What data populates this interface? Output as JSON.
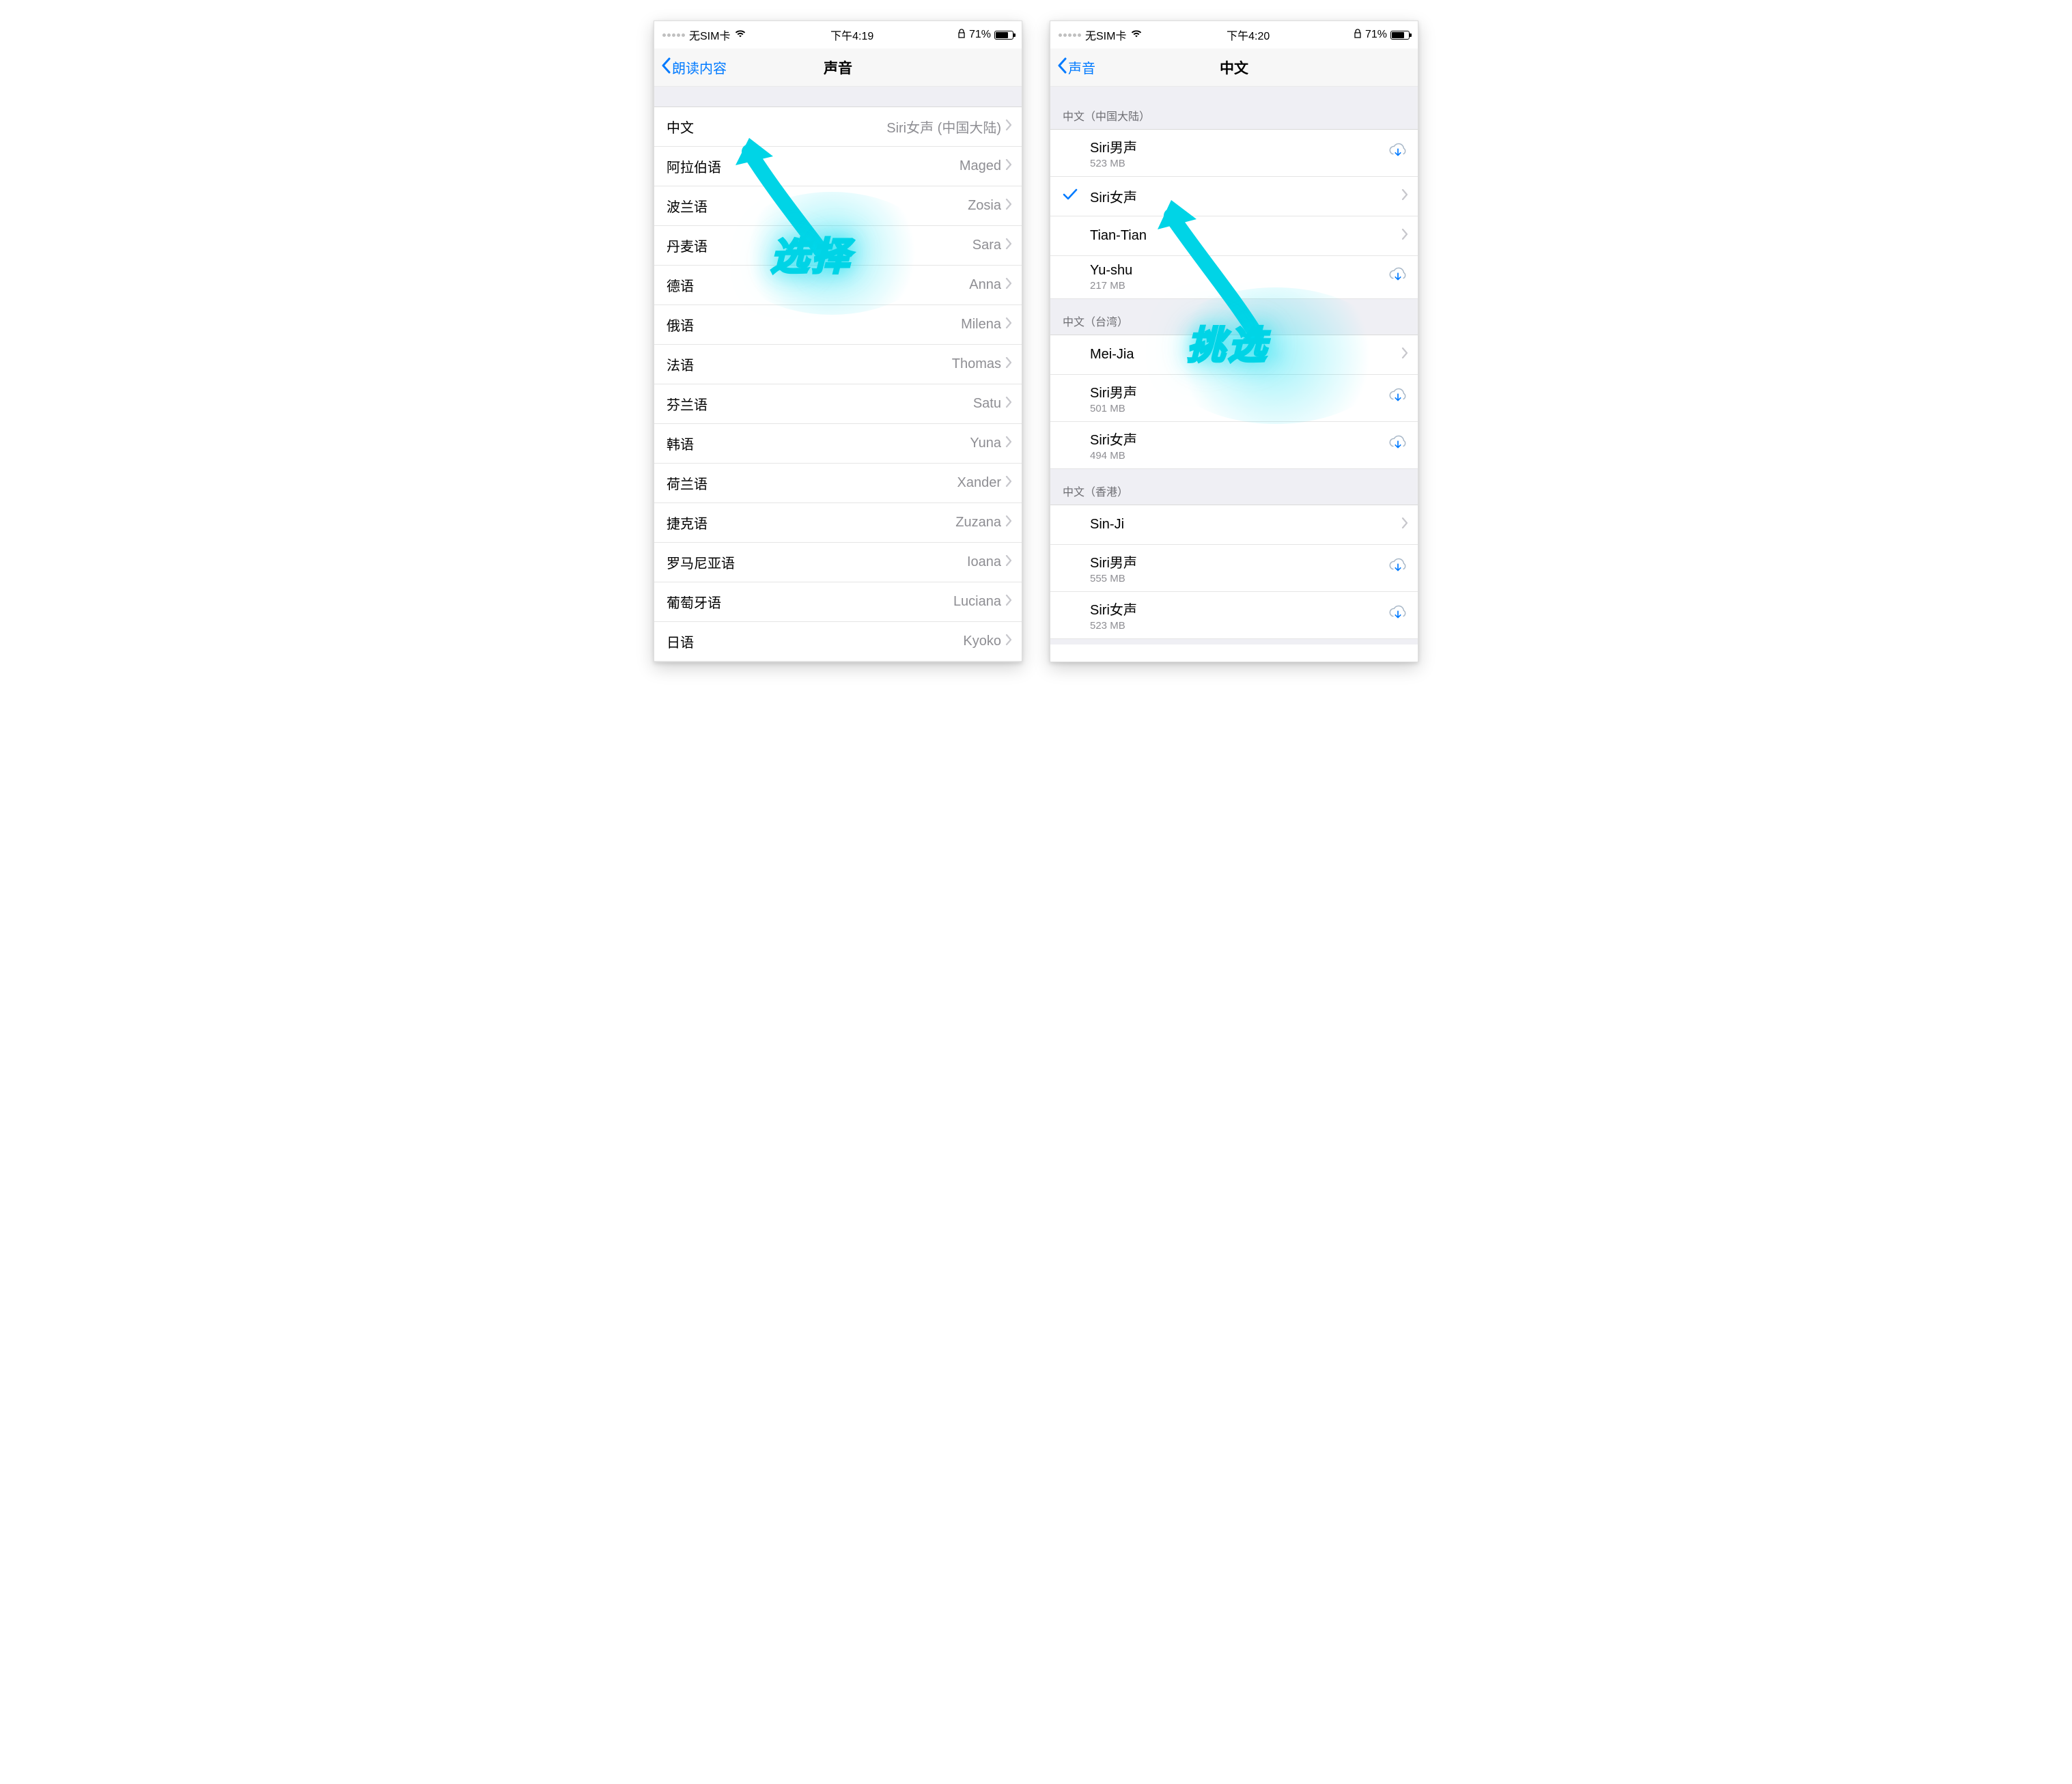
{
  "left": {
    "status": {
      "carrier": "无SIM卡",
      "time": "下午4:19",
      "battery_pct": "71%"
    },
    "nav": {
      "back": "朗读内容",
      "title": "声音"
    },
    "rows": [
      {
        "label": "中文",
        "detail": "Siri女声 (中国大陆)"
      },
      {
        "label": "阿拉伯语",
        "detail": "Maged"
      },
      {
        "label": "波兰语",
        "detail": "Zosia"
      },
      {
        "label": "丹麦语",
        "detail": "Sara"
      },
      {
        "label": "德语",
        "detail": "Anna"
      },
      {
        "label": "俄语",
        "detail": "Milena"
      },
      {
        "label": "法语",
        "detail": "Thomas"
      },
      {
        "label": "芬兰语",
        "detail": "Satu"
      },
      {
        "label": "韩语",
        "detail": "Yuna"
      },
      {
        "label": "荷兰语",
        "detail": "Xander"
      },
      {
        "label": "捷克语",
        "detail": "Zuzana"
      },
      {
        "label": "罗马尼亚语",
        "detail": "Ioana"
      },
      {
        "label": "葡萄牙语",
        "detail": "Luciana"
      },
      {
        "label": "日语",
        "detail": "Kyoko"
      }
    ],
    "annotation": "选择"
  },
  "right": {
    "status": {
      "carrier": "无SIM卡",
      "time": "下午4:20",
      "battery_pct": "71%"
    },
    "nav": {
      "back": "声音",
      "title": "中文"
    },
    "sections": [
      {
        "header": "中文（中国大陆）",
        "rows": [
          {
            "label": "Siri男声",
            "sub": "523 MB",
            "trail": "cloud"
          },
          {
            "label": "Siri女声",
            "sub": "",
            "trail": "chevron",
            "selected": true
          },
          {
            "label": "Tian-Tian",
            "sub": "",
            "trail": "chevron"
          },
          {
            "label": "Yu-shu",
            "sub": "217 MB",
            "trail": "cloud"
          }
        ]
      },
      {
        "header": "中文（台湾）",
        "rows": [
          {
            "label": "Mei-Jia",
            "sub": "",
            "trail": "chevron"
          },
          {
            "label": "Siri男声",
            "sub": "501 MB",
            "trail": "cloud"
          },
          {
            "label": "Siri女声",
            "sub": "494 MB",
            "trail": "cloud"
          }
        ]
      },
      {
        "header": "中文（香港）",
        "rows": [
          {
            "label": "Sin-Ji",
            "sub": "",
            "trail": "chevron"
          },
          {
            "label": "Siri男声",
            "sub": "555 MB",
            "trail": "cloud"
          },
          {
            "label": "Siri女声",
            "sub": "523 MB",
            "trail": "cloud"
          }
        ]
      }
    ],
    "annotation": "挑选"
  },
  "colors": {
    "accent": "#007aff",
    "secondary_text": "#8e8e93",
    "group_bg": "#efeff4",
    "annotation": "#00d4e6"
  }
}
